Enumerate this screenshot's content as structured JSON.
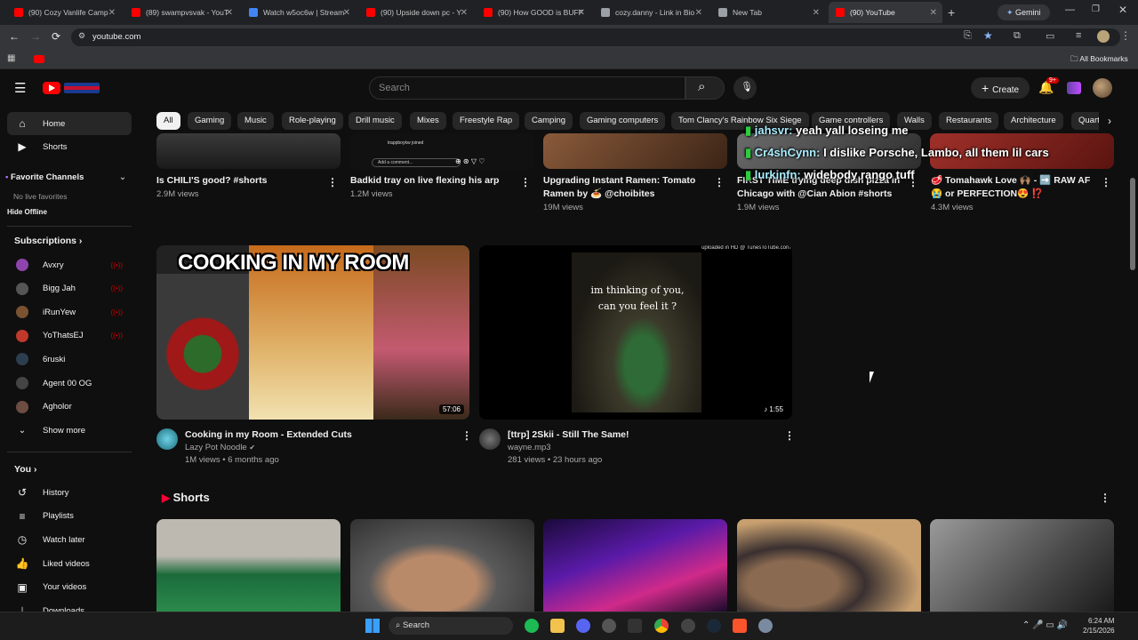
{
  "browser": {
    "tabs": [
      {
        "label": "(90) Cozy Vanlife Camp",
        "color": "#ff0000"
      },
      {
        "label": "(89) swampvsvak - YouT",
        "color": "#ff0000"
      },
      {
        "label": "Watch w5oc6w | Stream",
        "color": "#4285f4"
      },
      {
        "label": "(90) Upside down pc - Y",
        "color": "#ff0000"
      },
      {
        "label": "(90) How GOOD is BUFF",
        "color": "#ff0000"
      },
      {
        "label": "cozy.danny - Link in Bio",
        "color": "#9aa0a6"
      },
      {
        "label": "New Tab",
        "color": "#9aa0a6"
      },
      {
        "label": "(90) YouTube",
        "color": "#ff0000"
      }
    ],
    "gemini_label": "Gemini",
    "url": "youtube.com",
    "all_bookmarks": "All Bookmarks"
  },
  "header": {
    "search_placeholder": "Search",
    "create_label": "Create",
    "notif_count": "9+"
  },
  "chips": [
    "All",
    "Gaming",
    "Music",
    "Role-playing",
    "Drill music",
    "Mixes",
    "Freestyle Rap",
    "Camping",
    "Gaming computers",
    "Tom Clancy's Rainbow Six Siege",
    "Game controllers",
    "Walls",
    "Restaurants",
    "Architecture",
    "Quarte"
  ],
  "sidebar": {
    "home": "Home",
    "shorts": "Shorts",
    "favorite_channels": "Favorite Channels",
    "no_live": "No live favorites",
    "hide_offline": "Hide Offline",
    "subscriptions": "Subscriptions",
    "subs": [
      {
        "name": "Avxry",
        "color": "#8e44ad"
      },
      {
        "name": "Bigg Jah",
        "color": "#555555"
      },
      {
        "name": "iRunYew",
        "color": "#7a5230"
      },
      {
        "name": "YoThatsEJ",
        "color": "#c0392b"
      },
      {
        "name": "6ruski",
        "color": "#2c3e50"
      },
      {
        "name": "Agent 00 OG",
        "color": "#444444"
      },
      {
        "name": "Agholor",
        "color": "#6d4c41"
      }
    ],
    "show_more": "Show more",
    "you": "You",
    "you_items": [
      "History",
      "Playlists",
      "Watch later",
      "Liked videos",
      "Your videos",
      "Downloads"
    ]
  },
  "top_row": [
    {
      "title": "Is CHILI'S good? #shorts",
      "title2": "",
      "views": "2.9M views"
    },
    {
      "title": "Badkid tray on live flexing his arp",
      "title2": "",
      "views": "1.2M views",
      "overlay_user": "trappboykw joined",
      "overlay_comment": "Add a comment..."
    },
    {
      "title": "Upgrading Instant Ramen: Tomato",
      "title2": "Ramen by 🍝 @choibites",
      "views": "19M views"
    },
    {
      "title": "FIRST TIME trying deep dish pizza in",
      "title2": "Chicago with @Cian Abion #shorts",
      "views": "1.9M views"
    },
    {
      "title": "🥩 Tomahawk Love 🙌🏽 - ➡️ RAW AF",
      "title2": "😭 or PERFECTION😍 ⁉️",
      "views": "4.3M views"
    }
  ],
  "videos": [
    {
      "thumb_text": "COOKING IN MY ROOM",
      "duration": "57:06",
      "title": "Cooking in my Room - Extended Cuts",
      "channel": "Lazy Pot Noodle",
      "meta": "1M views • 6 months ago"
    },
    {
      "thumb_text_1": "im thinking of you,",
      "thumb_text_2": "can you feel it ?",
      "watermark": "uploaded in HD @ TunesToTube.com",
      "duration": "1:55",
      "title": "[ttrp] 2Skii - Still The Same!",
      "channel": "wayne.mp3",
      "meta": "281 views • 23 hours ago"
    }
  ],
  "shorts_heading": "Shorts",
  "chat_overlay": [
    {
      "name": "jahsvr:",
      "text": "yeah yall loseing me"
    },
    {
      "name": "Cr4shCynn:",
      "text": "I dislike Porsche, Lambo, all them lil cars"
    },
    {
      "name": "lurkinfn:",
      "text": "widebody rango tuff"
    }
  ],
  "taskbar": {
    "search_label": "Search",
    "time": "6:24 AM",
    "date": "2/15/2026"
  }
}
